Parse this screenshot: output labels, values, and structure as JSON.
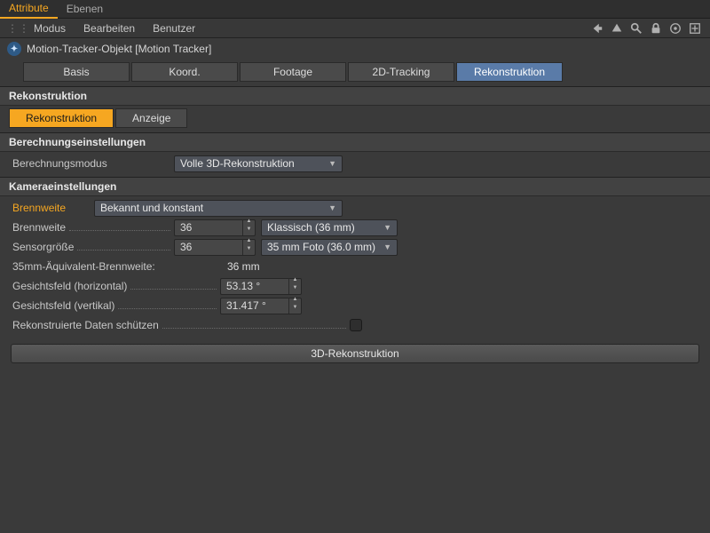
{
  "topTabs": {
    "attribute": "Attribute",
    "ebenen": "Ebenen"
  },
  "menu": {
    "modus": "Modus",
    "bearbeiten": "Bearbeiten",
    "benutzer": "Benutzer"
  },
  "object": {
    "title": "Motion-Tracker-Objekt [Motion Tracker]"
  },
  "mainTabs": {
    "basis": "Basis",
    "koord": "Koord.",
    "footage": "Footage",
    "tracking2d": "2D-Tracking",
    "rekon": "Rekonstruktion"
  },
  "sections": {
    "rekonHeader": "Rekonstruktion",
    "berechnung": "Berechnungseinstellungen",
    "kamera": "Kameraeinstellungen"
  },
  "subTabs": {
    "rekon": "Rekonstruktion",
    "anzeige": "Anzeige"
  },
  "fields": {
    "berechnungsmodus": {
      "label": "Berechnungsmodus",
      "value": "Volle 3D-Rekonstruktion"
    },
    "brennweiteMode": {
      "label": "Brennweite",
      "value": "Bekannt und konstant"
    },
    "brennweite": {
      "label": "Brennweite",
      "value": "36",
      "preset": "Klassisch (36 mm)"
    },
    "sensor": {
      "label": "Sensorgröße",
      "value": "36",
      "preset": "35 mm Foto (36.0 mm)"
    },
    "equiv": {
      "label": "35mm-Äquivalent-Brennweite:",
      "value": "36 mm"
    },
    "fovH": {
      "label": "Gesichtsfeld (horizontal)",
      "value": "53.13 °"
    },
    "fovV": {
      "label": "Gesichtsfeld (vertikal)",
      "value": "31.417 °"
    },
    "protect": {
      "label": "Rekonstruierte Daten schützen"
    }
  },
  "button": {
    "reconstruct": "3D-Rekonstruktion"
  }
}
